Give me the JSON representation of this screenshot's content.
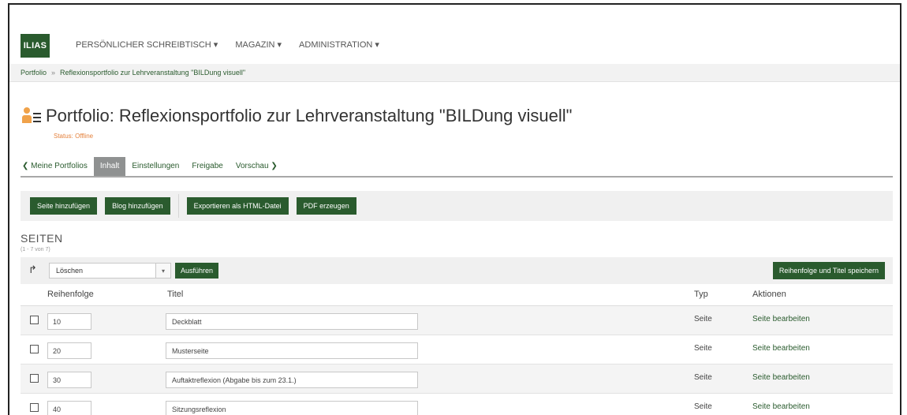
{
  "header": {
    "logo": "ILIAS",
    "nav": [
      "PERSÖNLICHER SCHREIBTISCH ▾",
      "MAGAZIN ▾",
      "ADMINISTRATION ▾"
    ]
  },
  "breadcrumb": {
    "items": [
      "Portfolio",
      "Reflexionsportfolio zur Lehrveranstaltung \"BILDung visuell\""
    ],
    "separator": "»"
  },
  "page": {
    "title": "Portfolio: Reflexionsportfolio zur Lehrveranstaltung \"BILDung visuell\"",
    "status": "Status: Offline",
    "icon": "portfolio-icon"
  },
  "tabs": [
    {
      "label": "❮ Meine Portfolios",
      "active": false
    },
    {
      "label": "Inhalt",
      "active": true
    },
    {
      "label": "Einstellungen",
      "active": false
    },
    {
      "label": "Freigabe",
      "active": false
    },
    {
      "label": "Vorschau ❯",
      "active": false
    }
  ],
  "toolbar": {
    "add_page": "Seite hinzufügen",
    "add_blog": "Blog hinzufügen",
    "export_html": "Exportieren als HTML-Datei",
    "create_pdf": "PDF erzeugen"
  },
  "section": {
    "title": "SEITEN",
    "subtitle": "(1 - 7 von 7)"
  },
  "actions": {
    "arrow": "↱",
    "select_value": "Löschen",
    "execute": "Ausführen",
    "save_order": "Reihenfolge und Titel speichern"
  },
  "table": {
    "headers": {
      "order": "Reihenfolge",
      "title": "Titel",
      "type": "Typ",
      "actions": "Aktionen"
    },
    "rows": [
      {
        "order": "10",
        "title": "Deckblatt",
        "type": "Seite",
        "action": "Seite bearbeiten"
      },
      {
        "order": "20",
        "title": "Musterseite",
        "type": "Seite",
        "action": "Seite bearbeiten"
      },
      {
        "order": "30",
        "title": "Auftaktreflexion (Abgabe bis zum 23.1.)",
        "type": "Seite",
        "action": "Seite bearbeiten"
      },
      {
        "order": "40",
        "title": "Sitzungsreflexion",
        "type": "Seite",
        "action": "Seite bearbeiten"
      }
    ]
  },
  "colors": {
    "brand": "#2a5b2e",
    "accent": "#f0a24a",
    "status": "#e4813c"
  }
}
